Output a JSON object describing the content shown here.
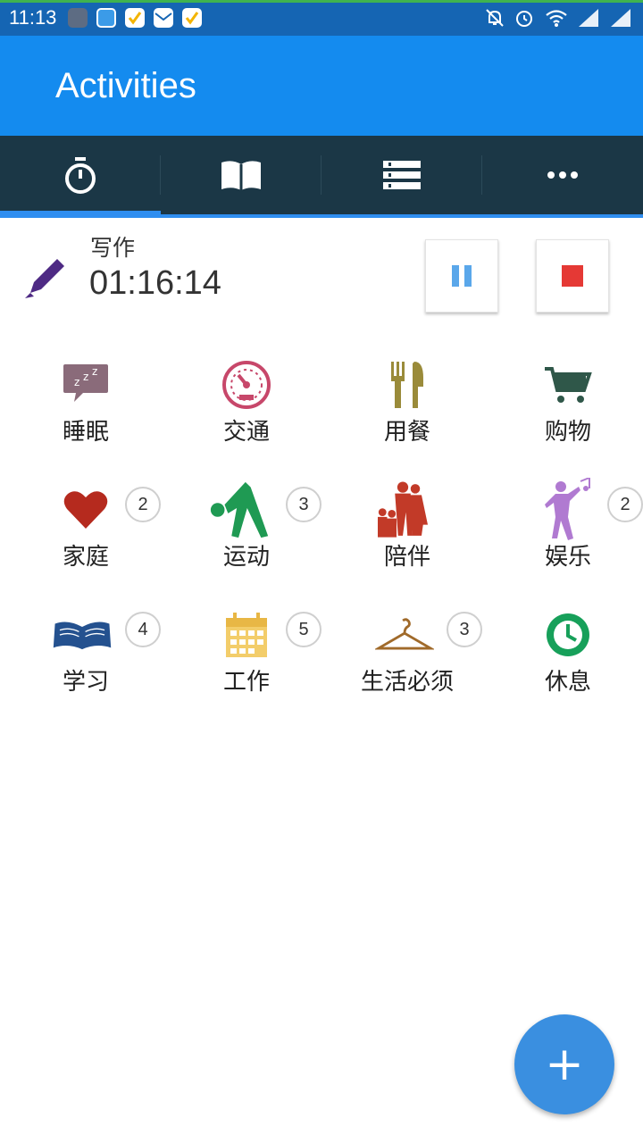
{
  "status_bar": {
    "time": "11:13"
  },
  "app_bar": {
    "title": "Activities"
  },
  "tabs": [
    {
      "icon": "stopwatch-icon"
    },
    {
      "icon": "book-icon"
    },
    {
      "icon": "list-icon"
    },
    {
      "icon": "more-icon"
    }
  ],
  "current_activity": {
    "name": "写作",
    "elapsed": "01:16:14",
    "icon": "pencil-icon"
  },
  "categories": [
    {
      "label": "睡眠",
      "badge": "",
      "icon": "sleep-icon"
    },
    {
      "label": "交通",
      "badge": "",
      "icon": "speedometer-icon"
    },
    {
      "label": "用餐",
      "badge": "",
      "icon": "cutlery-icon"
    },
    {
      "label": "购物",
      "badge": "",
      "icon": "cart-icon"
    },
    {
      "label": "家庭",
      "badge": "2",
      "icon": "heart-icon"
    },
    {
      "label": "运动",
      "badge": "3",
      "icon": "exercise-icon"
    },
    {
      "label": "陪伴",
      "badge": "",
      "icon": "family-icon"
    },
    {
      "label": "娱乐",
      "badge": "2",
      "icon": "dance-icon"
    },
    {
      "label": "学习",
      "badge": "4",
      "icon": "open-book-icon"
    },
    {
      "label": "工作",
      "badge": "5",
      "icon": "calendar-icon"
    },
    {
      "label": "生活必须",
      "badge": "3",
      "icon": "hanger-icon"
    },
    {
      "label": "休息",
      "badge": "",
      "icon": "clock-icon"
    }
  ],
  "fab": {
    "label": "+"
  },
  "colors": {
    "app_bar": "#148bef",
    "tab_bar": "#1b3746",
    "accent": "#2f8ef0",
    "stop": "#e53935"
  }
}
